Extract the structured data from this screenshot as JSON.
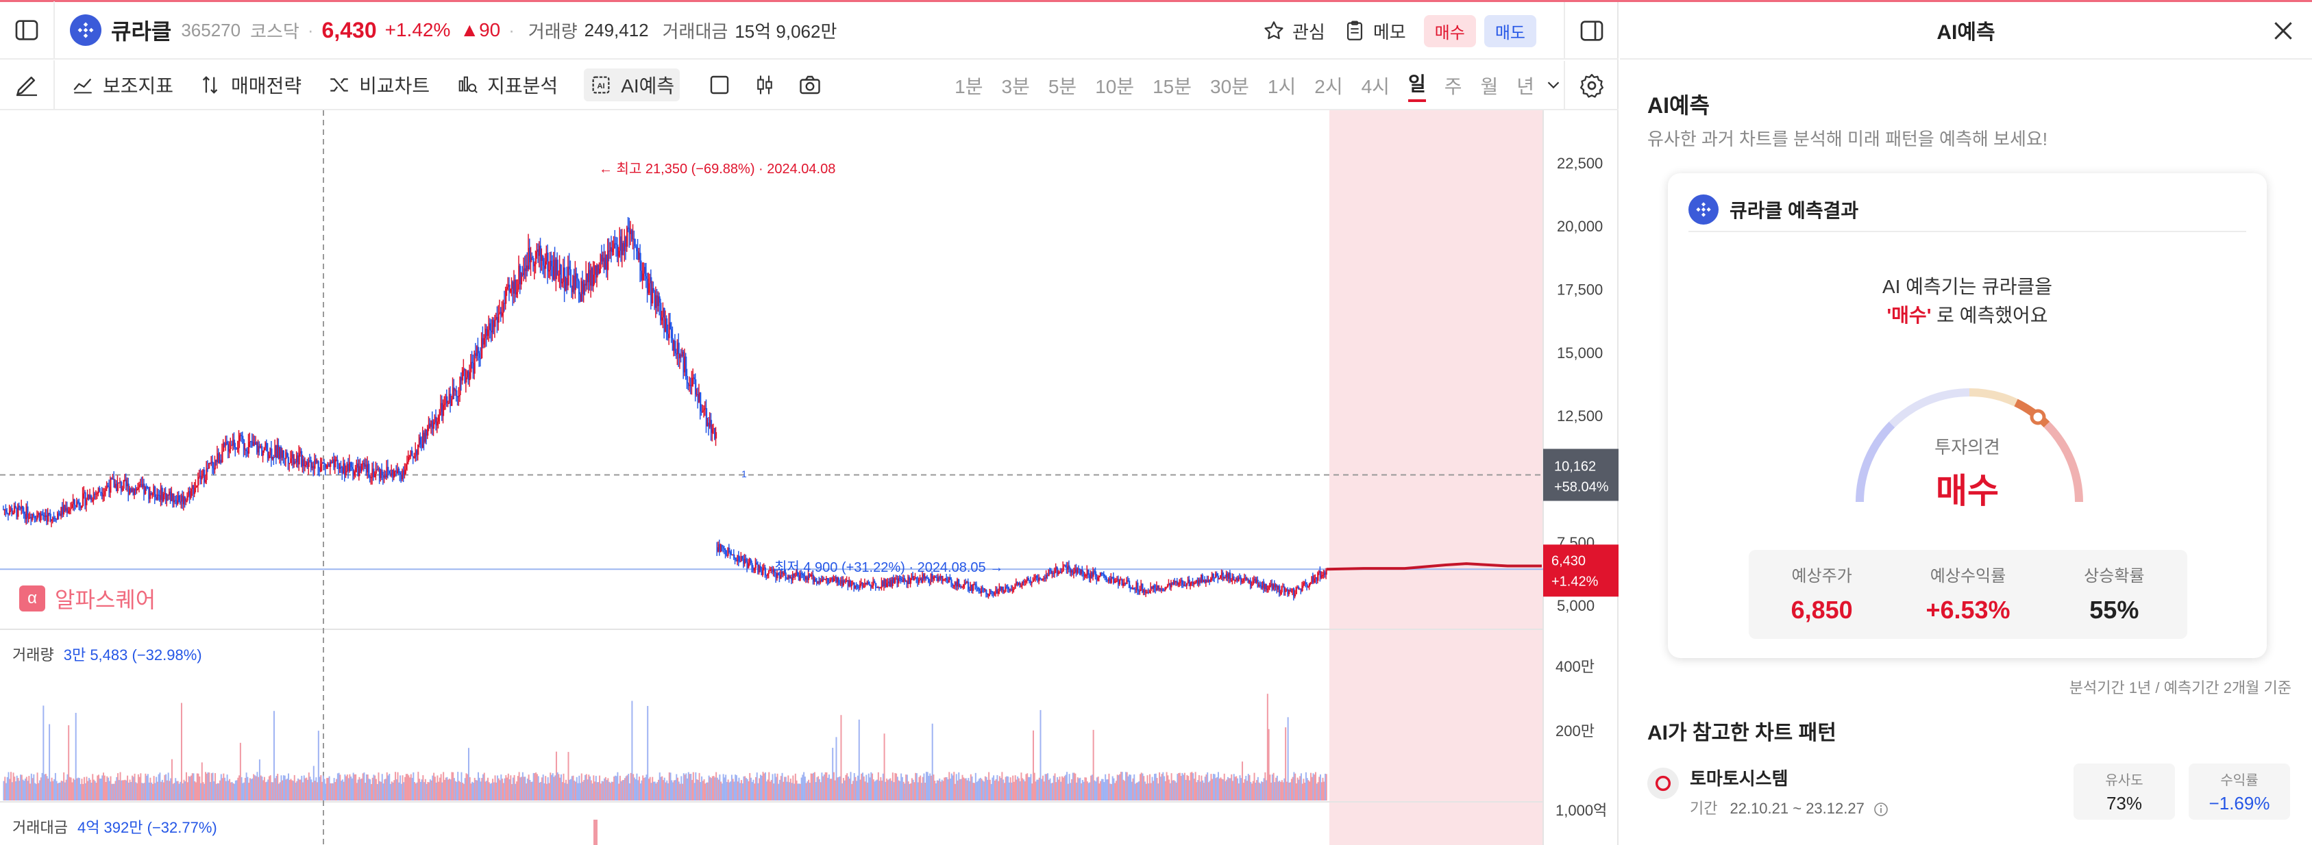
{
  "stock": {
    "name": "큐라클",
    "code": "365270",
    "market": "코스닥",
    "price": "6,430",
    "change_pct": "+1.42%",
    "change_abs": "▲90",
    "volume_label": "거래량",
    "volume": "249,412",
    "amount_label": "거래대금",
    "amount": "15억 9,062만"
  },
  "header_actions": {
    "watch": "관심",
    "memo": "메모",
    "buy": "매수",
    "sell": "매도"
  },
  "toolbar": {
    "indicator": "보조지표",
    "strategy": "매매전략",
    "compare": "비교차트",
    "analysis": "지표분석",
    "ai_predict": "AI예측",
    "ai_badge": "AI",
    "timeframes": [
      "1분",
      "3분",
      "5분",
      "10분",
      "15분",
      "30분",
      "1시",
      "2시",
      "4시",
      "일",
      "주",
      "월",
      "년"
    ],
    "active_timeframe": "일"
  },
  "chart": {
    "high_annotation": "최고 21,350 (−69.88%) · 2024.04.08",
    "low_annotation": "최저 4,900 (+31.22%) · 2024.08.05",
    "marker_1": "1",
    "y_ticks": [
      "22,500",
      "20,000",
      "17,500",
      "15,000",
      "12,500",
      "7,500",
      "5,000"
    ],
    "crosshair_price": "10,162",
    "crosshair_pct": "+58.04%",
    "current_price": "6,430",
    "current_pct": "+1.42%",
    "watermark": "알파스퀘어",
    "watermark_icon": "α",
    "volume_legend_label": "거래량",
    "volume_legend_value": "3만 5,483 (−32.98%)",
    "volume_ticks": [
      "400만",
      "200만"
    ],
    "amount_legend_label": "거래대금",
    "amount_legend_value": "4억 392만 (−32.77%)",
    "amount_tick": "1,000억",
    "colors": {
      "up": "#e0142d",
      "down": "#2456e6",
      "forecast_bg": "#fbe3e6"
    }
  },
  "chart_data": {
    "type": "candlestick",
    "ylim": [
      4000,
      23500
    ],
    "high": 21350,
    "low": 4900,
    "close": 6430,
    "forecast_target": 6850
  },
  "ai_panel": {
    "title": "AI예측",
    "section_title": "AI예측",
    "subtitle": "유사한 과거 차트를 분석해 미래 패턴을 예측해 보세요!",
    "card_title": "큐라클 예측결과",
    "pred_line1": "AI 예측기는 큐라클을",
    "pred_highlight": "'매수'",
    "pred_line2_rest": " 로 예측했어요",
    "opinion_label": "투자의견",
    "opinion_value": "매수",
    "stats": [
      {
        "label": "예상주가",
        "value": "6,850"
      },
      {
        "label": "예상수익률",
        "value": "+6.53%"
      },
      {
        "label": "상승확률",
        "value": "55%"
      }
    ],
    "basis": "분석기간 1년 / 예측기간 2개월 기준",
    "pattern_title": "AI가 참고한 차트 패턴",
    "pattern": {
      "name": "토마토시스템",
      "period_label": "기간",
      "period": "22.10.21 ~ 23.12.27",
      "similarity_label": "유사도",
      "similarity": "73%",
      "return_label": "수익률",
      "return": "−1.69%"
    }
  }
}
